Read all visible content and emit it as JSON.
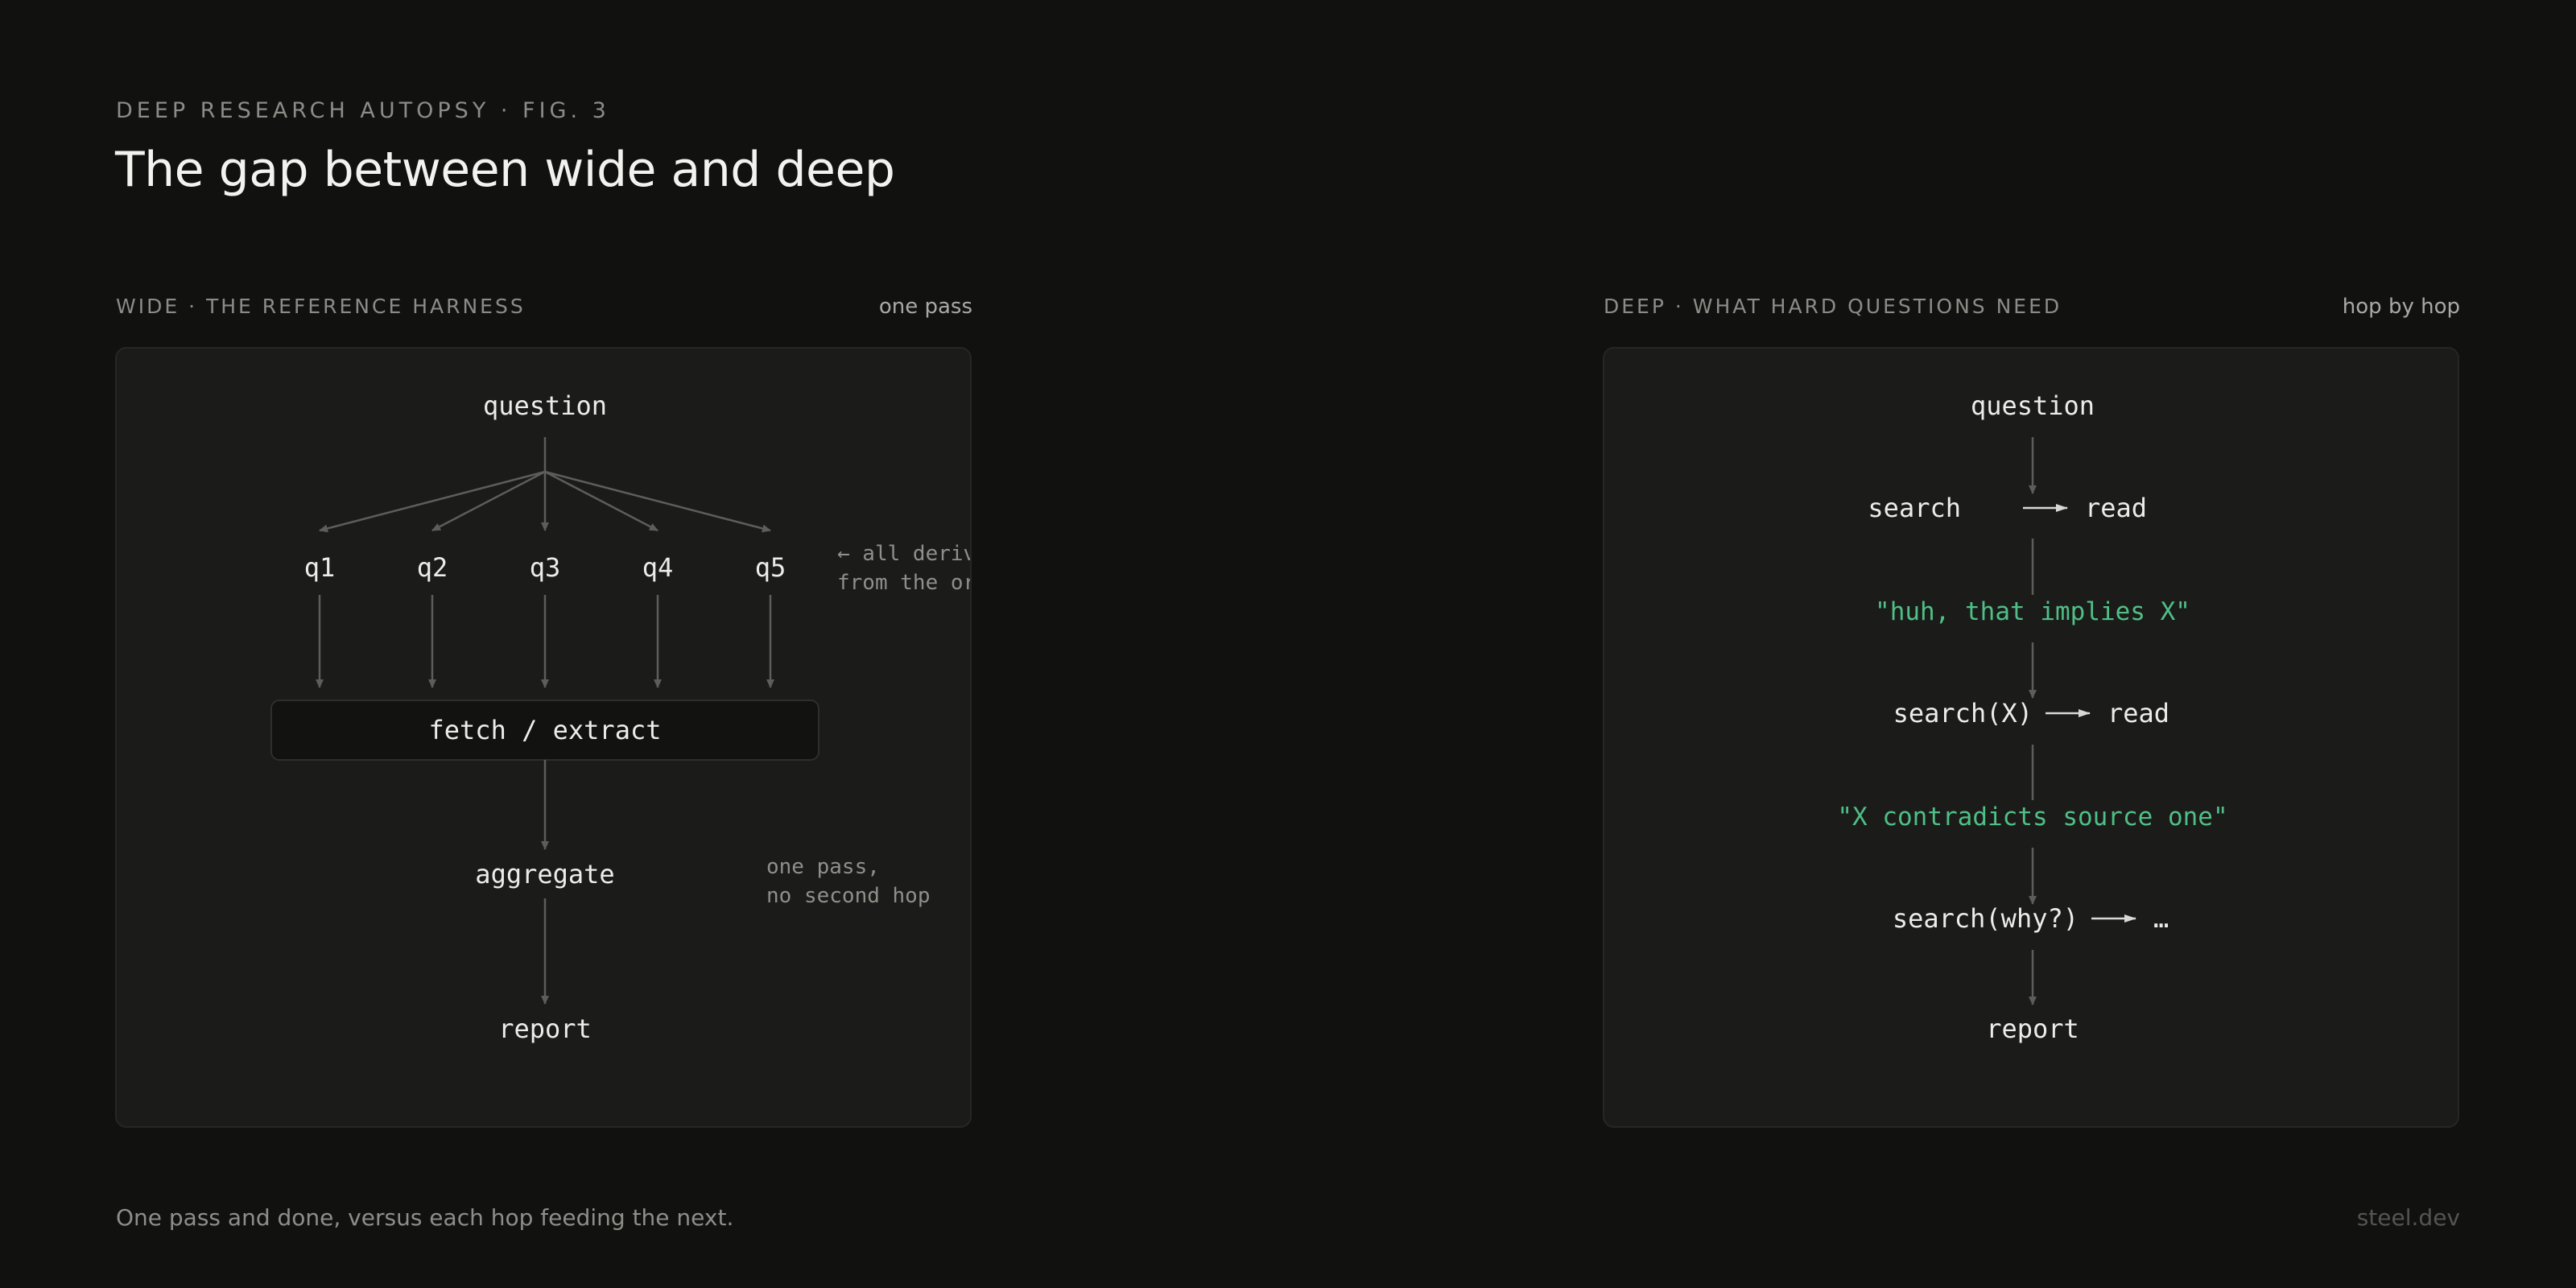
{
  "header": {
    "eyebrow": "DEEP RESEARCH AUTOPSY · FIG. 3",
    "title": "The gap between wide and deep"
  },
  "wide": {
    "label": "WIDE · THE REFERENCE HARNESS",
    "note": "one pass",
    "question": "question",
    "subqueries": [
      "q1",
      "q2",
      "q3",
      "q4",
      "q5"
    ],
    "derived_note": [
      "← all derived",
      "from the original Q"
    ],
    "fetch": "fetch / extract",
    "aggregate": "aggregate",
    "pass_note": [
      "one pass,",
      "no second hop"
    ],
    "report": "report"
  },
  "deep": {
    "label": "DEEP · WHAT HARD QUESTIONS NEED",
    "note": "hop by hop",
    "question": "question",
    "hop1": {
      "search": "search",
      "read": "read"
    },
    "insight1": "\"huh, that implies X\"",
    "hop2": {
      "search": "search(X)",
      "read": "read"
    },
    "insight2": "\"X contradicts source one\"",
    "hop3": {
      "search": "search(why?)",
      "read": "…"
    },
    "report": "report"
  },
  "colors": {
    "background": "#111110",
    "panel": "#1b1b1a",
    "insight": "#4fbf86",
    "arrow": "#5d5d59"
  },
  "footer": {
    "caption": "One pass and done, versus each hop feeding the next.",
    "brand": "steel.dev"
  }
}
